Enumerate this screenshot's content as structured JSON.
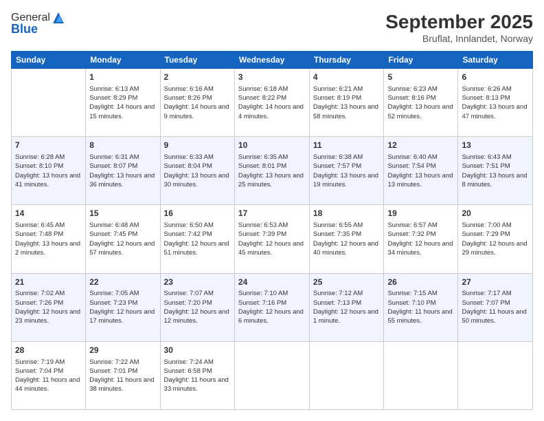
{
  "logo": {
    "general": "General",
    "blue": "Blue"
  },
  "title": "September 2025",
  "subtitle": "Bruflat, Innlandet, Norway",
  "headers": [
    "Sunday",
    "Monday",
    "Tuesday",
    "Wednesday",
    "Thursday",
    "Friday",
    "Saturday"
  ],
  "rows": [
    [
      {
        "day": "",
        "sunrise": "",
        "sunset": "",
        "daylight": ""
      },
      {
        "day": "1",
        "sunrise": "Sunrise: 6:13 AM",
        "sunset": "Sunset: 8:29 PM",
        "daylight": "Daylight: 14 hours and 15 minutes."
      },
      {
        "day": "2",
        "sunrise": "Sunrise: 6:16 AM",
        "sunset": "Sunset: 8:26 PM",
        "daylight": "Daylight: 14 hours and 9 minutes."
      },
      {
        "day": "3",
        "sunrise": "Sunrise: 6:18 AM",
        "sunset": "Sunset: 8:22 PM",
        "daylight": "Daylight: 14 hours and 4 minutes."
      },
      {
        "day": "4",
        "sunrise": "Sunrise: 6:21 AM",
        "sunset": "Sunset: 8:19 PM",
        "daylight": "Daylight: 13 hours and 58 minutes."
      },
      {
        "day": "5",
        "sunrise": "Sunrise: 6:23 AM",
        "sunset": "Sunset: 8:16 PM",
        "daylight": "Daylight: 13 hours and 52 minutes."
      },
      {
        "day": "6",
        "sunrise": "Sunrise: 6:26 AM",
        "sunset": "Sunset: 8:13 PM",
        "daylight": "Daylight: 13 hours and 47 minutes."
      }
    ],
    [
      {
        "day": "7",
        "sunrise": "Sunrise: 6:28 AM",
        "sunset": "Sunset: 8:10 PM",
        "daylight": "Daylight: 13 hours and 41 minutes."
      },
      {
        "day": "8",
        "sunrise": "Sunrise: 6:31 AM",
        "sunset": "Sunset: 8:07 PM",
        "daylight": "Daylight: 13 hours and 36 minutes."
      },
      {
        "day": "9",
        "sunrise": "Sunrise: 6:33 AM",
        "sunset": "Sunset: 8:04 PM",
        "daylight": "Daylight: 13 hours and 30 minutes."
      },
      {
        "day": "10",
        "sunrise": "Sunrise: 6:35 AM",
        "sunset": "Sunset: 8:01 PM",
        "daylight": "Daylight: 13 hours and 25 minutes."
      },
      {
        "day": "11",
        "sunrise": "Sunrise: 6:38 AM",
        "sunset": "Sunset: 7:57 PM",
        "daylight": "Daylight: 13 hours and 19 minutes."
      },
      {
        "day": "12",
        "sunrise": "Sunrise: 6:40 AM",
        "sunset": "Sunset: 7:54 PM",
        "daylight": "Daylight: 13 hours and 13 minutes."
      },
      {
        "day": "13",
        "sunrise": "Sunrise: 6:43 AM",
        "sunset": "Sunset: 7:51 PM",
        "daylight": "Daylight: 13 hours and 8 minutes."
      }
    ],
    [
      {
        "day": "14",
        "sunrise": "Sunrise: 6:45 AM",
        "sunset": "Sunset: 7:48 PM",
        "daylight": "Daylight: 13 hours and 2 minutes."
      },
      {
        "day": "15",
        "sunrise": "Sunrise: 6:48 AM",
        "sunset": "Sunset: 7:45 PM",
        "daylight": "Daylight: 12 hours and 57 minutes."
      },
      {
        "day": "16",
        "sunrise": "Sunrise: 6:50 AM",
        "sunset": "Sunset: 7:42 PM",
        "daylight": "Daylight: 12 hours and 51 minutes."
      },
      {
        "day": "17",
        "sunrise": "Sunrise: 6:53 AM",
        "sunset": "Sunset: 7:39 PM",
        "daylight": "Daylight: 12 hours and 45 minutes."
      },
      {
        "day": "18",
        "sunrise": "Sunrise: 6:55 AM",
        "sunset": "Sunset: 7:35 PM",
        "daylight": "Daylight: 12 hours and 40 minutes."
      },
      {
        "day": "19",
        "sunrise": "Sunrise: 6:57 AM",
        "sunset": "Sunset: 7:32 PM",
        "daylight": "Daylight: 12 hours and 34 minutes."
      },
      {
        "day": "20",
        "sunrise": "Sunrise: 7:00 AM",
        "sunset": "Sunset: 7:29 PM",
        "daylight": "Daylight: 12 hours and 29 minutes."
      }
    ],
    [
      {
        "day": "21",
        "sunrise": "Sunrise: 7:02 AM",
        "sunset": "Sunset: 7:26 PM",
        "daylight": "Daylight: 12 hours and 23 minutes."
      },
      {
        "day": "22",
        "sunrise": "Sunrise: 7:05 AM",
        "sunset": "Sunset: 7:23 PM",
        "daylight": "Daylight: 12 hours and 17 minutes."
      },
      {
        "day": "23",
        "sunrise": "Sunrise: 7:07 AM",
        "sunset": "Sunset: 7:20 PM",
        "daylight": "Daylight: 12 hours and 12 minutes."
      },
      {
        "day": "24",
        "sunrise": "Sunrise: 7:10 AM",
        "sunset": "Sunset: 7:16 PM",
        "daylight": "Daylight: 12 hours and 6 minutes."
      },
      {
        "day": "25",
        "sunrise": "Sunrise: 7:12 AM",
        "sunset": "Sunset: 7:13 PM",
        "daylight": "Daylight: 12 hours and 1 minute."
      },
      {
        "day": "26",
        "sunrise": "Sunrise: 7:15 AM",
        "sunset": "Sunset: 7:10 PM",
        "daylight": "Daylight: 11 hours and 55 minutes."
      },
      {
        "day": "27",
        "sunrise": "Sunrise: 7:17 AM",
        "sunset": "Sunset: 7:07 PM",
        "daylight": "Daylight: 11 hours and 50 minutes."
      }
    ],
    [
      {
        "day": "28",
        "sunrise": "Sunrise: 7:19 AM",
        "sunset": "Sunset: 7:04 PM",
        "daylight": "Daylight: 11 hours and 44 minutes."
      },
      {
        "day": "29",
        "sunrise": "Sunrise: 7:22 AM",
        "sunset": "Sunset: 7:01 PM",
        "daylight": "Daylight: 11 hours and 38 minutes."
      },
      {
        "day": "30",
        "sunrise": "Sunrise: 7:24 AM",
        "sunset": "Sunset: 6:58 PM",
        "daylight": "Daylight: 11 hours and 33 minutes."
      },
      {
        "day": "",
        "sunrise": "",
        "sunset": "",
        "daylight": ""
      },
      {
        "day": "",
        "sunrise": "",
        "sunset": "",
        "daylight": ""
      },
      {
        "day": "",
        "sunrise": "",
        "sunset": "",
        "daylight": ""
      },
      {
        "day": "",
        "sunrise": "",
        "sunset": "",
        "daylight": ""
      }
    ]
  ]
}
